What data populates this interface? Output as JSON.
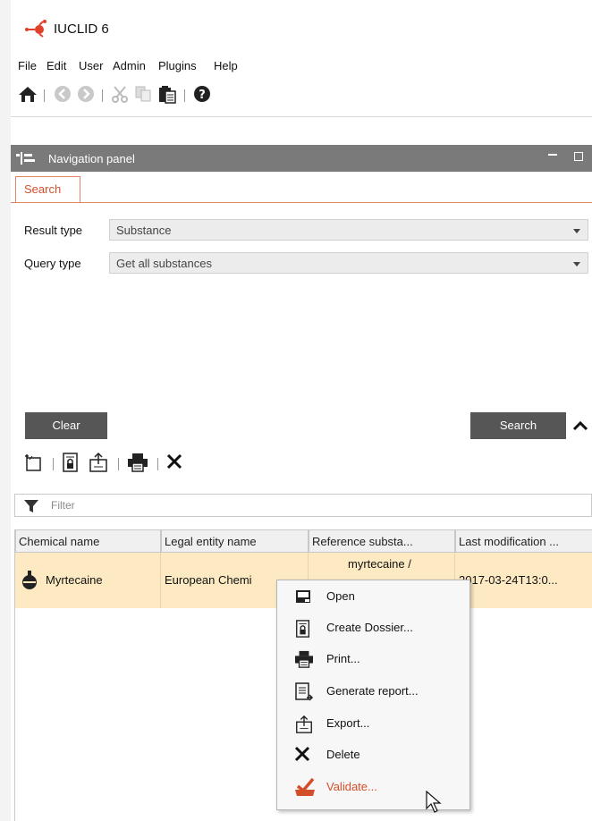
{
  "app": {
    "title": "IUCLID 6"
  },
  "menubar": {
    "items": [
      "File",
      "Edit",
      "User",
      "Admin",
      "Plugins",
      "Help"
    ]
  },
  "toolbar": {
    "icons": [
      "home-icon",
      "back-icon",
      "forward-icon",
      "cut-icon",
      "copy-icon",
      "paste-icon",
      "help-icon"
    ]
  },
  "navigation_panel": {
    "title": "Navigation panel",
    "tab_label": "Search",
    "result_type": {
      "label": "Result type",
      "value": "Substance"
    },
    "query_type": {
      "label": "Query type",
      "value": "Get all substances"
    },
    "clear_label": "Clear",
    "search_label": "Search"
  },
  "action_toolbar": {
    "icons": [
      "new-icon",
      "create-dossier-icon",
      "export-icon",
      "print-icon",
      "delete-icon"
    ]
  },
  "filter": {
    "placeholder": "Filter"
  },
  "table": {
    "columns": [
      "Chemical name",
      "Legal entity name",
      "Reference substa...",
      "Last modification ..."
    ],
    "rows": [
      {
        "chemical_name": "Myrtecaine",
        "legal_entity": "European Chemi",
        "reference_substance": "myrtecaine /",
        "last_modification": "2017-03-24T13:0..."
      }
    ]
  },
  "context_menu": {
    "items": [
      {
        "label": "Open",
        "icon": "open-icon"
      },
      {
        "label": "Create Dossier...",
        "icon": "create-dossier-icon"
      },
      {
        "label": "Print...",
        "icon": "print-icon"
      },
      {
        "label": "Generate report...",
        "icon": "report-icon"
      },
      {
        "label": "Export...",
        "icon": "export-icon"
      },
      {
        "label": "Delete",
        "icon": "delete-icon"
      },
      {
        "label": "Validate...",
        "icon": "validate-icon",
        "highlight": "#d34f2a"
      }
    ]
  },
  "colors": {
    "accent": "#d34f2a",
    "header": "#7a7a7a",
    "row_selected": "#fdeac3",
    "button": "#565656"
  }
}
